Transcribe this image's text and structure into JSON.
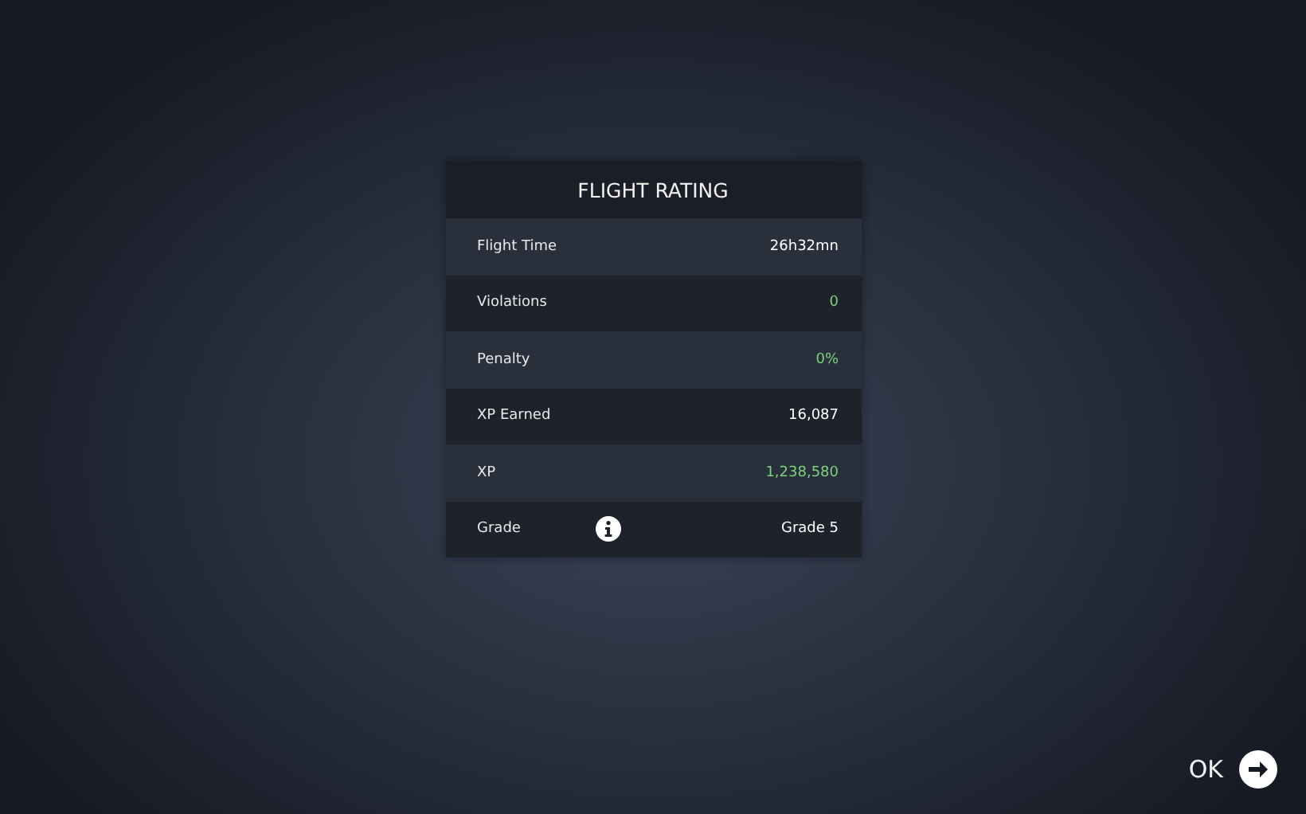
{
  "panel": {
    "title": "FLIGHT RATING",
    "rows": [
      {
        "label": "Flight Time",
        "value": "26h32mn",
        "color": "#ffffff",
        "info": false
      },
      {
        "label": "Violations",
        "value": "0",
        "color": "#7ed07e",
        "info": false
      },
      {
        "label": "Penalty",
        "value": "0%",
        "color": "#7ed07e",
        "info": false
      },
      {
        "label": "XP Earned",
        "value": "16,087",
        "color": "#ffffff",
        "info": false
      },
      {
        "label": "XP",
        "value": "1,238,580",
        "color": "#7ed07e",
        "info": false
      },
      {
        "label": "Grade",
        "value": "Grade 5",
        "color": "#ffffff",
        "info": true
      }
    ]
  },
  "ok_button": {
    "label": "OK"
  }
}
